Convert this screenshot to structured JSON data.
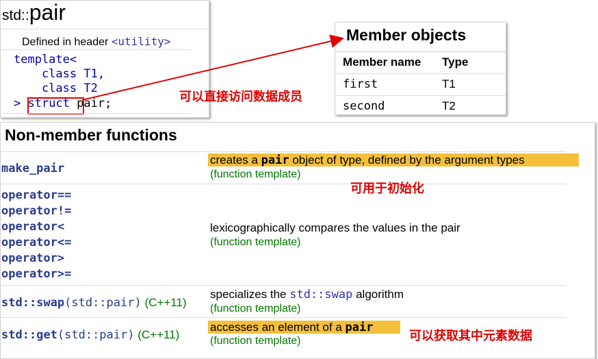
{
  "pair": {
    "title_prefix": "std::",
    "title_main": "pair",
    "defined_in": "Defined in header ",
    "header": "<utility>",
    "code": {
      "line1": "template<",
      "line2": "    class T1,",
      "line3": "    class T2",
      "line4_prefix": "> ",
      "line4_struct": "struct",
      "line4_rest": " pair;"
    }
  },
  "member_objects": {
    "title": "Member objects",
    "headers": [
      "Member name",
      "Type"
    ],
    "rows": [
      {
        "name": "first",
        "type": "T1"
      },
      {
        "name": "second",
        "type": "T2"
      }
    ]
  },
  "non_member": {
    "title": "Non-member functions",
    "rows": [
      {
        "names": [
          "make_pair"
        ],
        "desc_prefix": "creates a ",
        "desc_code": "pair",
        "desc_suffix": " object of type, defined by the argument types",
        "tag": "(function template)"
      },
      {
        "names": [
          "operator==",
          "operator!=",
          "operator<",
          "operator<=",
          "operator>",
          "operator>="
        ],
        "desc": "lexicographically compares the values in the pair",
        "tag": "(function template)"
      },
      {
        "name_main": "std::swap",
        "name_args": "(std::pair)",
        "name_std": "(C++11)",
        "desc_prefix": "specializes the ",
        "desc_code": "std::swap",
        "desc_suffix": " algorithm",
        "tag": "(function template)"
      },
      {
        "name_main": "std::get",
        "name_args": "(std::pair)",
        "name_std": "(C++11)",
        "desc_prefix": "accesses an element of a ",
        "desc_code": "pair",
        "tag": "(function template)"
      }
    ]
  },
  "annotations": {
    "direct_access": "可以直接访问数据成员",
    "init": "可用于初始化",
    "get_element": "可以获取其中元素数据"
  },
  "colors": {
    "highlight": "#f4c03c",
    "annotation_red": "#e00000",
    "link_blue": "#2a3a8f",
    "template_green": "#007700"
  }
}
